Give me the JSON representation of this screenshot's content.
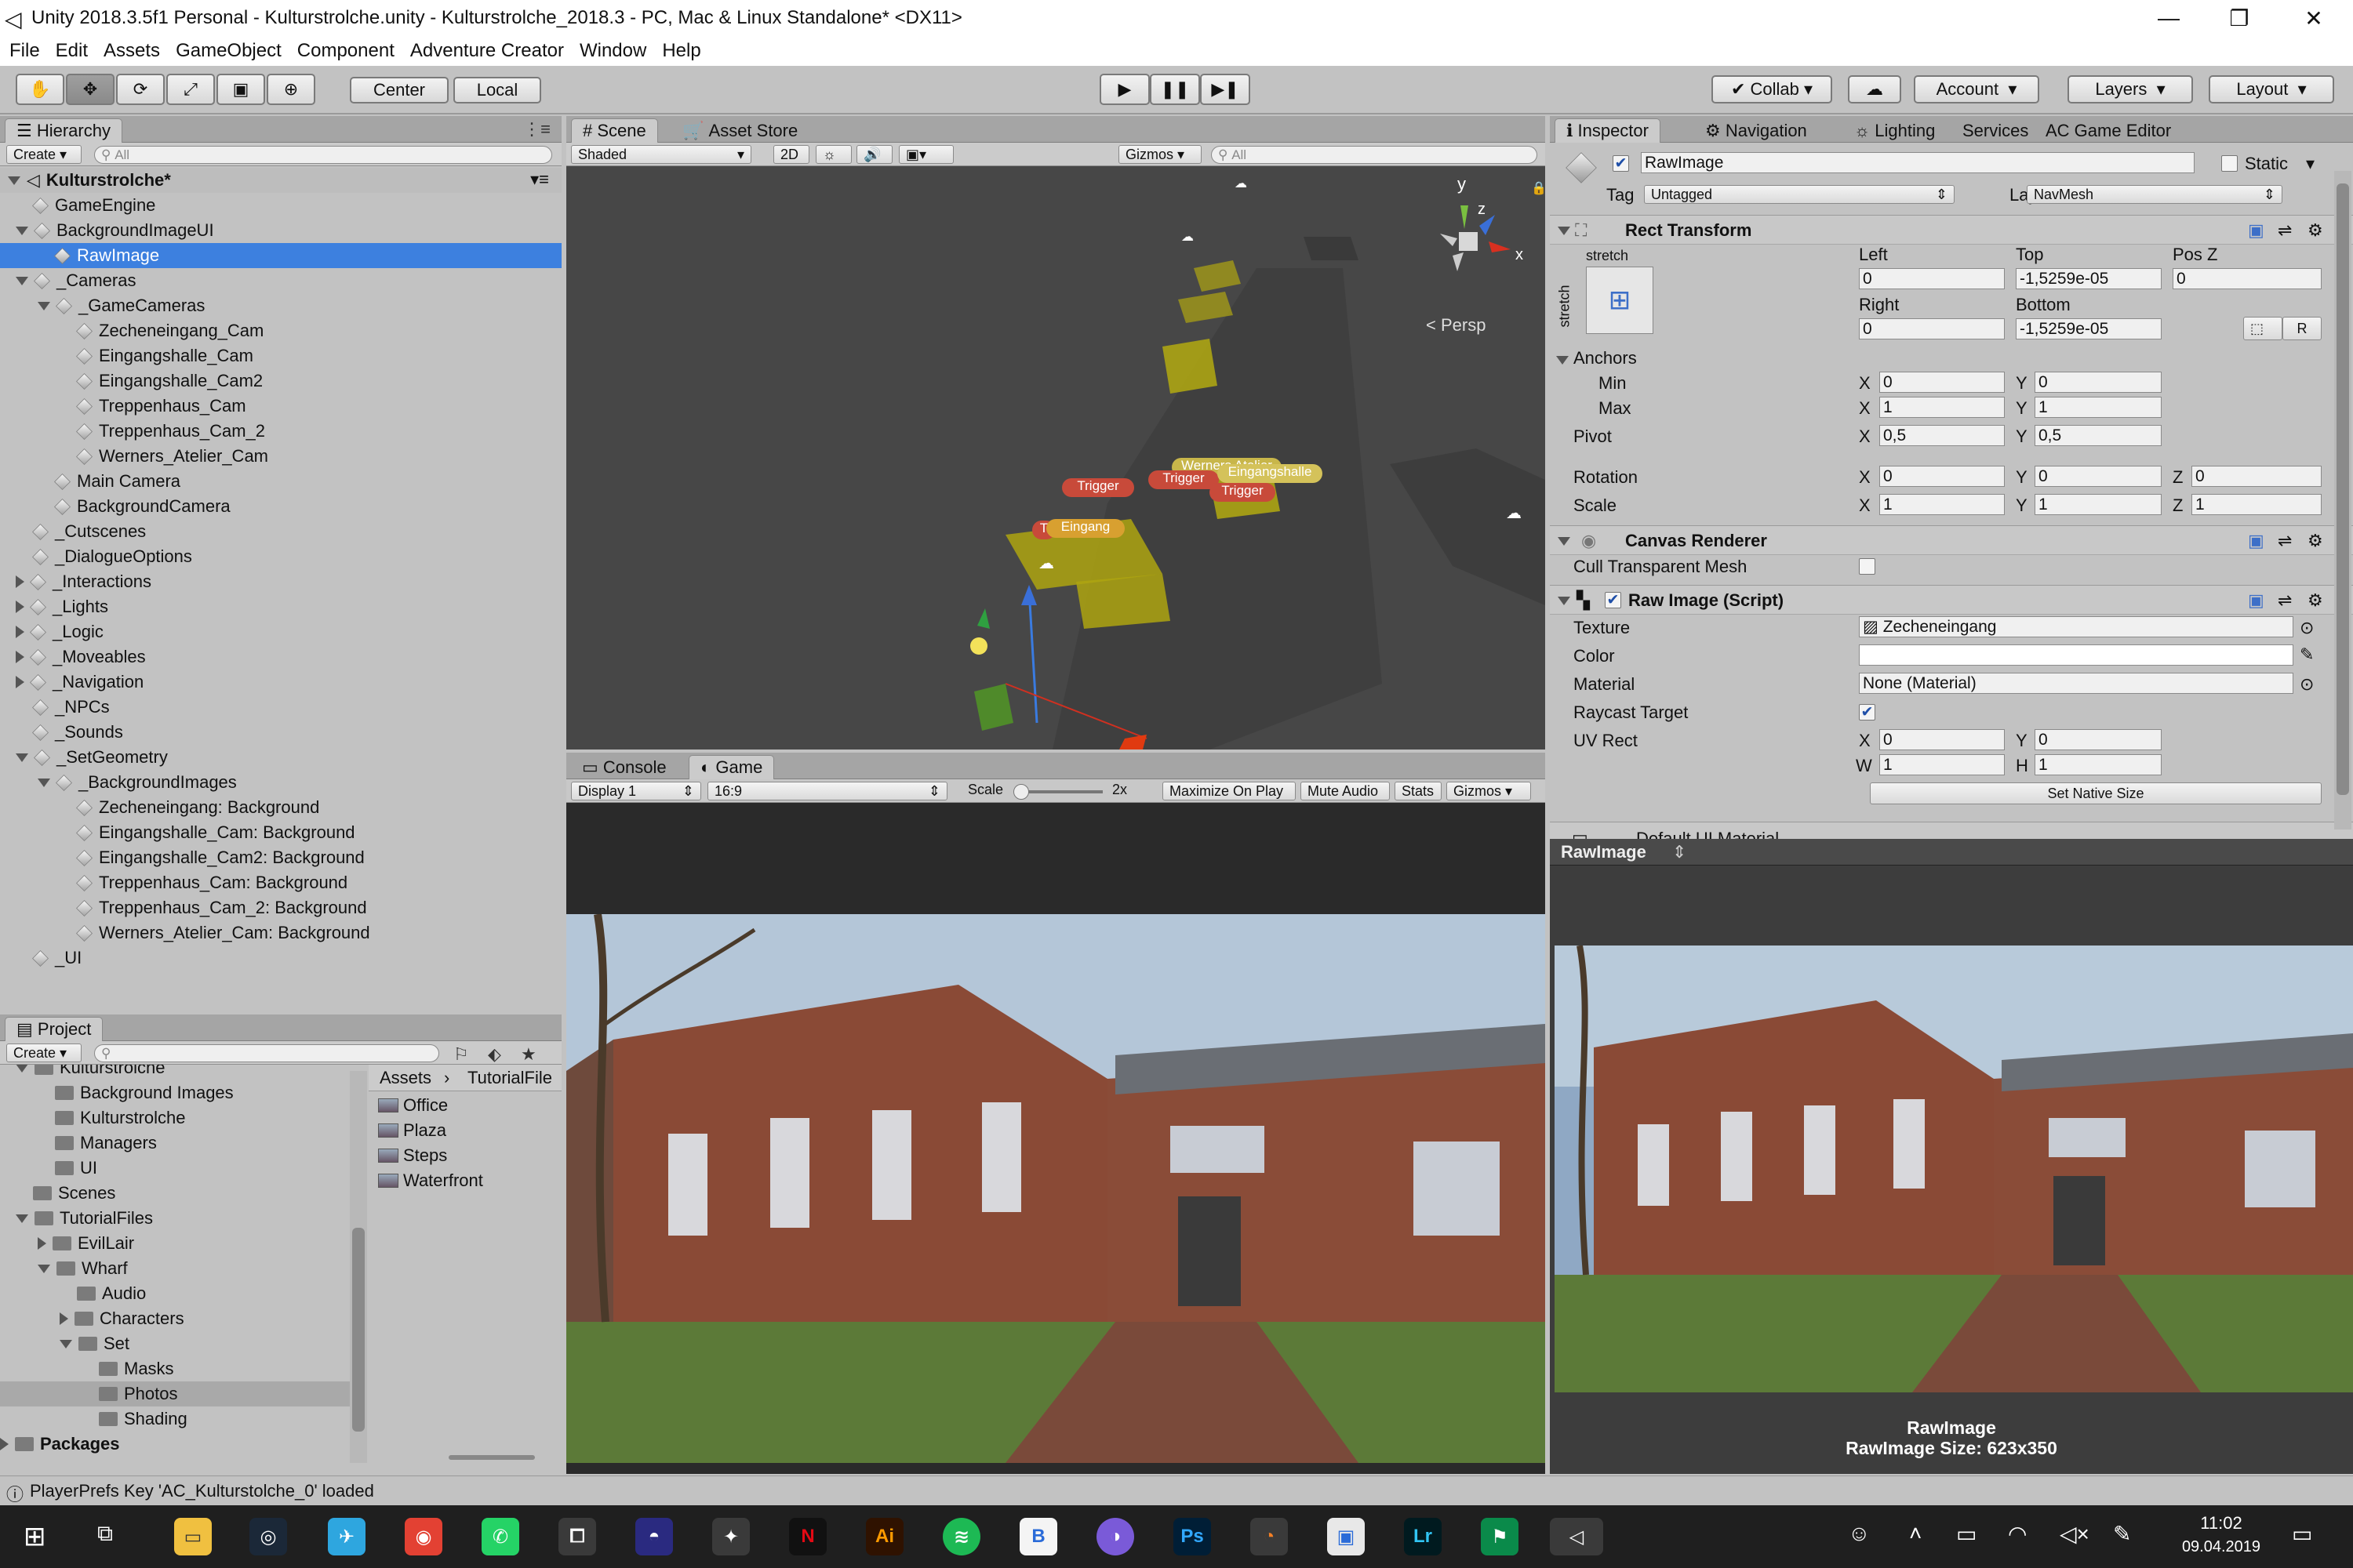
{
  "window": {
    "title": "Unity 2018.3.5f1 Personal - Kulturstrolche.unity - Kulturstrolche_2018.3 - PC, Mac & Linux Standalone* <DX11>"
  },
  "menu": [
    "File",
    "Edit",
    "Assets",
    "GameObject",
    "Component",
    "Adventure Creator",
    "Window",
    "Help"
  ],
  "toolbar": {
    "center": "Center",
    "local": "Local",
    "collab": "Collab",
    "account": "Account",
    "layers": "Layers",
    "layout": "Layout"
  },
  "hierarchy": {
    "tab": "Hierarchy",
    "create": "Create",
    "search_placeholder": "All",
    "scene": "Kulturstrolche*",
    "items": [
      "GameEngine",
      "BackgroundImageUI",
      "RawImage",
      "_Cameras",
      "_GameCameras",
      "Zecheneingang_Cam",
      "Eingangshalle_Cam",
      "Eingangshalle_Cam2",
      "Treppenhaus_Cam",
      "Treppenhaus_Cam_2",
      "Werners_Atelier_Cam",
      "Main Camera",
      "BackgroundCamera",
      "_Cutscenes",
      "_DialogueOptions",
      "_Interactions",
      "_Lights",
      "_Logic",
      "_Moveables",
      "_Navigation",
      "_NPCs",
      "_Sounds",
      "_SetGeometry",
      "_BackgroundImages",
      "Zecheneingang: Background",
      "Eingangshalle_Cam: Background",
      "Eingangshalle_Cam2: Background",
      "Treppenhaus_Cam: Background",
      "Treppenhaus_Cam_2: Background",
      "Werners_Atelier_Cam: Background",
      "_UI"
    ]
  },
  "project": {
    "tab": "Project",
    "create": "Create",
    "tree": [
      "Kulturstrolche",
      "Background Images",
      "Kulturstrolche",
      "Managers",
      "UI",
      "Scenes",
      "TutorialFiles",
      "EvilLair",
      "Wharf",
      "Audio",
      "Characters",
      "Set",
      "Masks",
      "Photos",
      "Shading",
      "Packages"
    ],
    "breadcrumb": [
      "Assets",
      "TutorialFile"
    ],
    "files": [
      "Office",
      "Plaza",
      "Steps",
      "Waterfront"
    ]
  },
  "scene": {
    "tab_scene": "Scene",
    "tab_asset": "Asset Store",
    "shaded": "Shaded",
    "mode2d": "2D",
    "gizmos": "Gizmos",
    "search_placeholder": "All",
    "persp": "Persp",
    "labels": [
      "Werners Atelier",
      "Trigger",
      "Trigger",
      "Eingangshalle",
      "Trigger",
      "Eingang",
      "T"
    ],
    "axis": {
      "y": "y",
      "z": "z",
      "x": "x"
    }
  },
  "game": {
    "tab_console": "Console",
    "tab_game": "Game",
    "display": "Display 1",
    "aspect": "16:9",
    "scale_label": "Scale",
    "scale_value": "2x",
    "max": "Maximize On Play",
    "mute": "Mute Audio",
    "stats": "Stats",
    "gizmos": "Gizmos"
  },
  "inspector": {
    "tabs": [
      "Inspector",
      "Navigation",
      "Lighting",
      "Services",
      "AC Game Editor"
    ],
    "name": "RawImage",
    "static": "Static",
    "tag_label": "Tag",
    "tag": "Untagged",
    "layer_label": "Layer",
    "layer": "NavMesh",
    "rect": {
      "title": "Rect Transform",
      "stretch": "stretch",
      "left_l": "Left",
      "top_l": "Top",
      "posz_l": "Pos Z",
      "left": "0",
      "top": "-1,5259e-05",
      "posz": "0",
      "right_l": "Right",
      "bottom_l": "Bottom",
      "right": "0",
      "bottom": "-1,5259e-05",
      "r": "R",
      "anchors": "Anchors",
      "min": "Min",
      "max": "Max",
      "min_x": "0",
      "min_y": "0",
      "max_x": "1",
      "max_y": "1",
      "pivot": "Pivot",
      "pivot_x": "0,5",
      "pivot_y": "0,5",
      "rotation": "Rotation",
      "rot_x": "0",
      "rot_y": "0",
      "rot_z": "0",
      "scale": "Scale",
      "sc_x": "1",
      "sc_y": "1",
      "sc_z": "1",
      "x": "X",
      "y": "Y",
      "z": "Z"
    },
    "canvas": {
      "title": "Canvas Renderer",
      "cull": "Cull Transparent Mesh"
    },
    "raw": {
      "title": "Raw Image (Script)",
      "texture_l": "Texture",
      "texture": "Zecheneingang",
      "color_l": "Color",
      "material_l": "Material",
      "material": "None (Material)",
      "raycast_l": "Raycast Target",
      "uv_l": "UV Rect",
      "uv_x": "0",
      "uv_y": "0",
      "uv_w": "1",
      "uv_h": "1",
      "w": "W",
      "h": "H",
      "native": "Set Native Size"
    },
    "next": "Default UI Material"
  },
  "preview": {
    "title": "RawImage",
    "caption1": "RawImage",
    "caption2": "RawImage Size: 623x350"
  },
  "status": "PlayerPrefs Key 'AC_Kulturstolche_0' loaded",
  "taskbar": {
    "time": "11:02",
    "date": "09.04.2019",
    "apps": [
      "Ai",
      "Ps",
      "Lr"
    ]
  },
  "colors": {
    "selection": "#3d80df",
    "panel": "#c2c2c2",
    "scene_bg": "#474747",
    "accent_yellow": "#c8c000"
  }
}
